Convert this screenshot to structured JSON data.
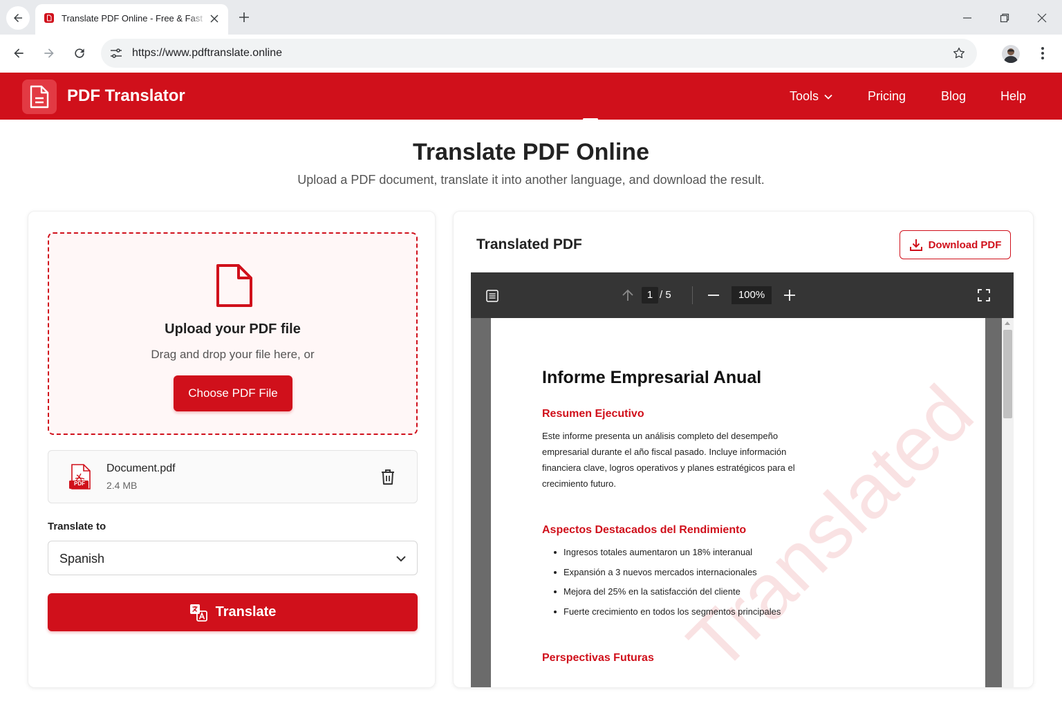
{
  "browser": {
    "tab_title": "Translate PDF Online - Free & Fast",
    "url": "https://www.pdftranslate.online",
    "icons": [
      "back-icon",
      "close-icon",
      "plus-icon",
      "minimize-icon",
      "restore-icon",
      "forward-icon",
      "reload-icon",
      "site-settings-icon",
      "star-icon",
      "avatar",
      "more-vert-icon"
    ]
  },
  "header": {
    "brand": "PDF Translator",
    "nav": {
      "tools": "Tools",
      "pricing": "Pricing",
      "blog": "Blog",
      "help": "Help"
    },
    "color": "#d0101b"
  },
  "hero": {
    "title": "Translate PDF Online",
    "subtitle": "Upload a PDF document, translate it into another language, and download the result."
  },
  "upload": {
    "title": "Upload your PDF file",
    "subtitle": "Drag and drop your file here, or",
    "button": "Choose PDF File"
  },
  "file": {
    "name": "Document.pdf",
    "size": "2.4 MB",
    "badge": "PDF"
  },
  "translate": {
    "label": "Translate to",
    "selected_language": "Spanish",
    "button": "Translate"
  },
  "preview": {
    "title": "Translated PDF",
    "download_button": "Download PDF",
    "viewer": {
      "current_page": "1",
      "total_pages": "/ 5",
      "zoom": "100%"
    },
    "document": {
      "title": "Informe Empresarial Anual",
      "section1_heading": "Resumen Ejecutivo",
      "section1_text": "Este informe presenta un análisis completo del desempeño empresarial durante el año fiscal pasado. Incluye información financiera clave, logros operativos y planes estratégicos para el crecimiento futuro.",
      "section2_heading": "Aspectos Destacados del Rendimiento",
      "bullets": [
        "Ingresos totales aumentaron un 18% interanual",
        "Expansión a 3 nuevos mercados internacionales",
        "Mejora del 25% en la satisfacción del cliente",
        "Fuerte crecimiento en todos los segmentos principales"
      ],
      "section3_heading": "Perspectivas Futuras",
      "watermark": "Translated"
    }
  }
}
